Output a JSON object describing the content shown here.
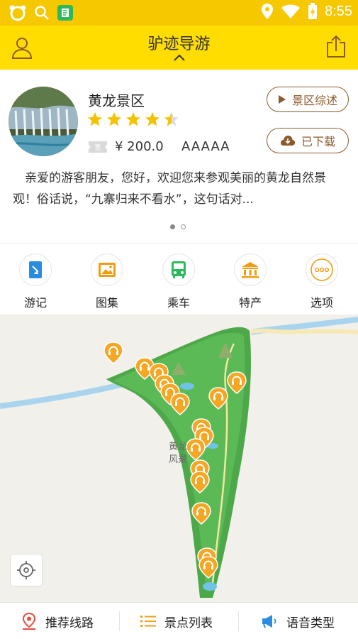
{
  "status": {
    "time": "8:55"
  },
  "app": {
    "title": "驴迹导游"
  },
  "scenic": {
    "name": "黄龙景区",
    "rating": 4.5,
    "price": "¥ 200.0",
    "grade": "AAAAA",
    "ticket_tag": "票",
    "overview_label": "景区综述",
    "download_label": "已下载",
    "description": "亲爱的游客朋友，您好，欢迎您来参观美丽的黄龙自然景观！俗话说，“九寨归来不看水”，这句话对..."
  },
  "carousel": {
    "pages": 2,
    "active": 0
  },
  "actions": [
    {
      "label": "游记",
      "icon": "travel-note-icon",
      "color": "#2A8CE0"
    },
    {
      "label": "图集",
      "icon": "gallery-icon",
      "color": "#F39C12"
    },
    {
      "label": "乘车",
      "icon": "bus-icon",
      "color": "#2EB85C"
    },
    {
      "label": "特产",
      "icon": "specialty-icon",
      "color": "#F39C12"
    },
    {
      "label": "选项",
      "icon": "more-icon",
      "color": "#F39C12"
    }
  ],
  "map": {
    "label_line1": "黄龙",
    "label_line2": "风景"
  },
  "bottom_tabs": [
    {
      "label": "推荐线路",
      "icon": "route-icon"
    },
    {
      "label": "景点列表",
      "icon": "list-icon"
    },
    {
      "label": "语音类型",
      "icon": "voice-icon"
    }
  ],
  "colors": {
    "accent": "#FFDD00",
    "brown": "#8B5A2B",
    "orange": "#F5A623",
    "green": "#2EB85C"
  }
}
